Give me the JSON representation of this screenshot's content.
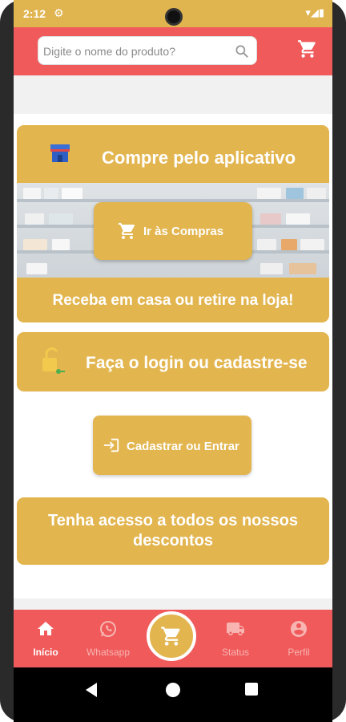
{
  "status_bar": {
    "time": "2:12",
    "indicators": "▾◢▮"
  },
  "header": {
    "search_placeholder": "Digite o nome do produto?",
    "search_icon": "search-icon",
    "cart_icon": "cart-icon"
  },
  "buy_card": {
    "title": "Compre pelo aplicativo",
    "button_label": "Ir às Compras",
    "footer_text": "Receba em casa ou retire na loja!"
  },
  "login_card": {
    "title": "Faça o login ou cadastre-se",
    "button_label": "Cadastrar ou Entrar"
  },
  "discount_card": {
    "text": "Tenha acesso a todos os nossos descontos"
  },
  "bottom_nav": {
    "items": [
      {
        "label": "Início",
        "icon": "home-icon",
        "active": true
      },
      {
        "label": "Whatsapp",
        "icon": "whatsapp-icon",
        "active": false
      },
      {
        "label": "Status",
        "icon": "truck-icon",
        "active": false
      },
      {
        "label": "Perfil",
        "icon": "profile-icon",
        "active": false
      }
    ],
    "center_icon": "cart-icon"
  },
  "colors": {
    "header_red": "#f05a5b",
    "gold": "#e2b54f",
    "status_gold": "#e0b44e",
    "background": "#f1f1f1"
  }
}
